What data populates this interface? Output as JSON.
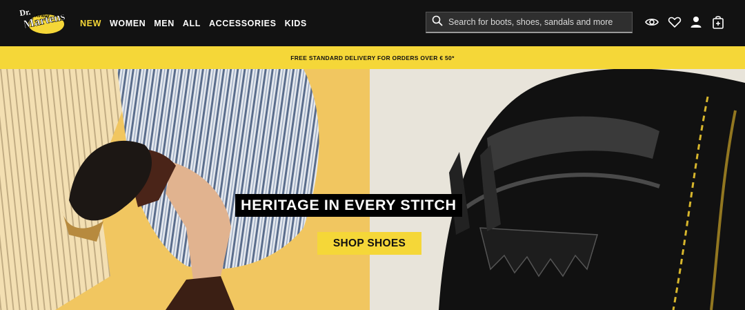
{
  "brand": {
    "logo_text_line1": "Dr.",
    "logo_text_line2": "Martens",
    "logo_text_line3": "AirWair",
    "accent_color": "#f5d738"
  },
  "nav": {
    "items": [
      {
        "label": "NEW",
        "active": true
      },
      {
        "label": "WOMEN",
        "active": false
      },
      {
        "label": "MEN",
        "active": false
      },
      {
        "label": "ALL",
        "active": false
      },
      {
        "label": "ACCESSORIES",
        "active": false
      },
      {
        "label": "KIDS",
        "active": false
      }
    ]
  },
  "search": {
    "placeholder": "Search for boots, shoes, sandals and more",
    "icon": "search-icon"
  },
  "header_icons": [
    "eye-icon",
    "heart-icon",
    "user-icon",
    "bag-icon"
  ],
  "promo": {
    "text": "FREE STANDARD DELIVERY FOR ORDERS OVER € 50*"
  },
  "hero": {
    "title": "HERITAGE IN EVERY STITCH",
    "cta_label": "SHOP SHOES"
  }
}
